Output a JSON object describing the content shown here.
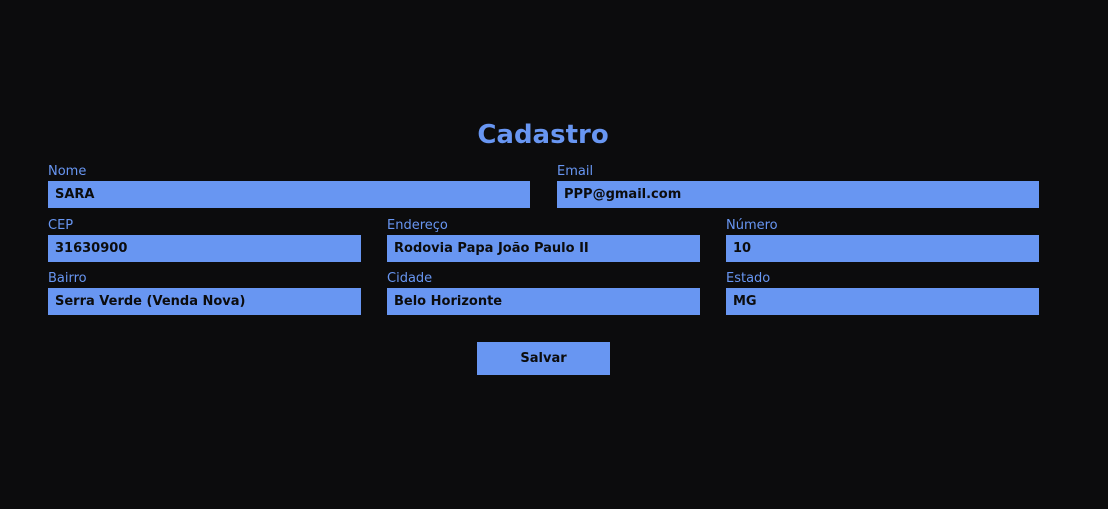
{
  "form": {
    "title": "Cadastro",
    "fields": {
      "nome": {
        "label": "Nome",
        "value": "SARA"
      },
      "email": {
        "label": "Email",
        "value": "PPP@gmail.com"
      },
      "cep": {
        "label": "CEP",
        "value": "31630900"
      },
      "endereco": {
        "label": "Endereço",
        "value": "Rodovia Papa João Paulo II"
      },
      "numero": {
        "label": "Número",
        "value": "10"
      },
      "bairro": {
        "label": "Bairro",
        "value": "Serra Verde (Venda Nova)"
      },
      "cidade": {
        "label": "Cidade",
        "value": "Belo Horizonte"
      },
      "estado": {
        "label": "Estado",
        "value": "MG"
      }
    },
    "submit_label": "Salvar"
  },
  "colors": {
    "background": "#0c0c0d",
    "accent": "#6896f2",
    "input_text": "#0c0c0d"
  }
}
